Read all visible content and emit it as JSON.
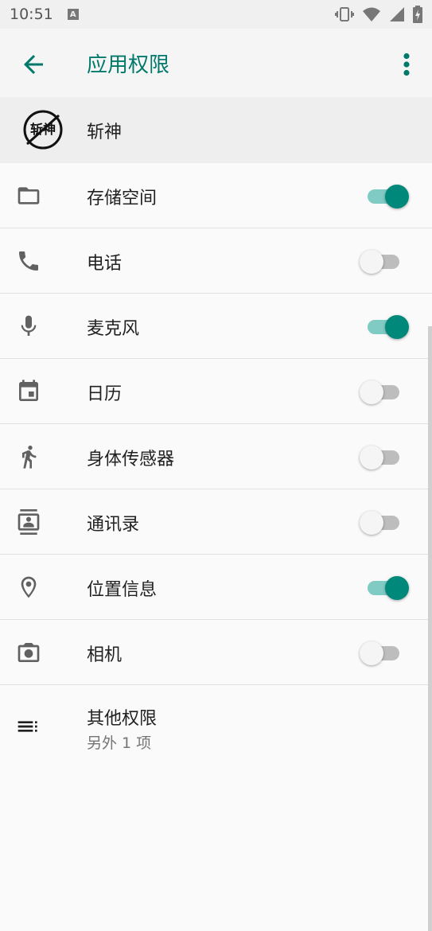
{
  "status_bar": {
    "time": "10:51",
    "notification_icon": "A"
  },
  "app_bar": {
    "title": "应用权限",
    "back_icon": "arrow-left",
    "menu_icon": "more-vert"
  },
  "app": {
    "name": "斩神",
    "logo_text": "斩神"
  },
  "permissions": [
    {
      "label": "存储空间",
      "icon": "folder-icon",
      "enabled": true
    },
    {
      "label": "电话",
      "icon": "phone-icon",
      "enabled": false
    },
    {
      "label": "麦克风",
      "icon": "microphone-icon",
      "enabled": true
    },
    {
      "label": "日历",
      "icon": "calendar-icon",
      "enabled": false
    },
    {
      "label": "身体传感器",
      "icon": "running-icon",
      "enabled": false
    },
    {
      "label": "通讯录",
      "icon": "contacts-icon",
      "enabled": false
    },
    {
      "label": "位置信息",
      "icon": "location-icon",
      "enabled": true
    },
    {
      "label": "相机",
      "icon": "camera-icon",
      "enabled": false
    }
  ],
  "other": {
    "label": "其他权限",
    "sub": "另外 1 项"
  },
  "colors": {
    "accent": "#00897b",
    "title": "#00796b"
  }
}
